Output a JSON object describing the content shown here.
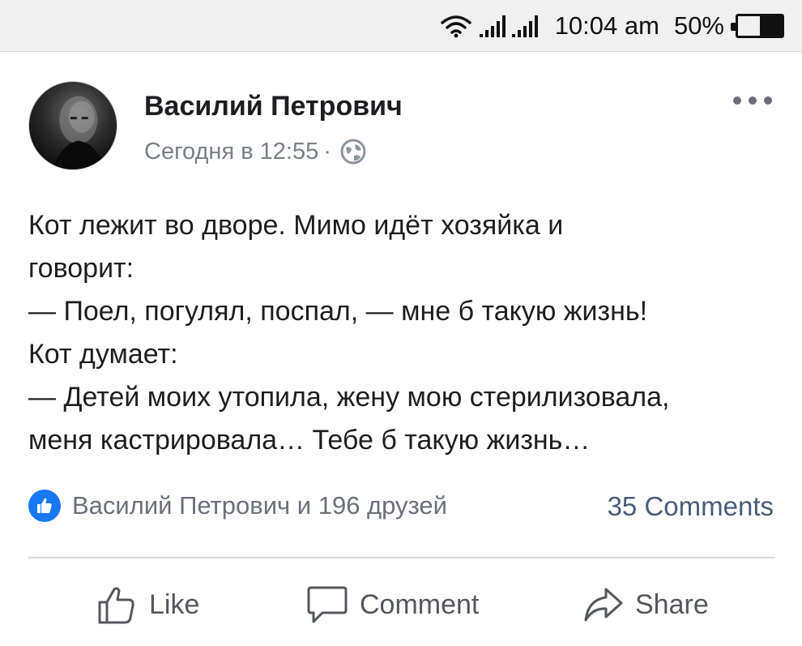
{
  "status_bar": {
    "time": "10:04 am",
    "battery_text": "50%",
    "battery_level": 0.5,
    "icons": [
      "wifi-icon",
      "signal-icon",
      "signal-icon",
      "battery-icon"
    ]
  },
  "post": {
    "author": "Василий Петрович",
    "timestamp": "Сегодня в 12:55",
    "separator": "·",
    "privacy_icon": "globe-icon",
    "text_lines": [
      "Кот лежит во дворе. Мимо идёт хозяйка и",
      "говорит:",
      "— Поел, погулял, поспал, — мне б такую жизнь!",
      "Кот думает:",
      "— Детей моих утопила, жену мою стерилизовала,",
      "меня кастрировала… Тебе б такую жизнь…"
    ],
    "reactions_text": "Василий Петрович и 196 друзей",
    "comments_count": "35 Comments"
  },
  "actions": {
    "like": "Like",
    "comment": "Comment",
    "share": "Share"
  },
  "colors": {
    "status_bar_bg": "#f0f0f0",
    "like_badge": "#1877f2",
    "comments_link": "#4b5c78",
    "meta_text": "#7a7f87"
  }
}
